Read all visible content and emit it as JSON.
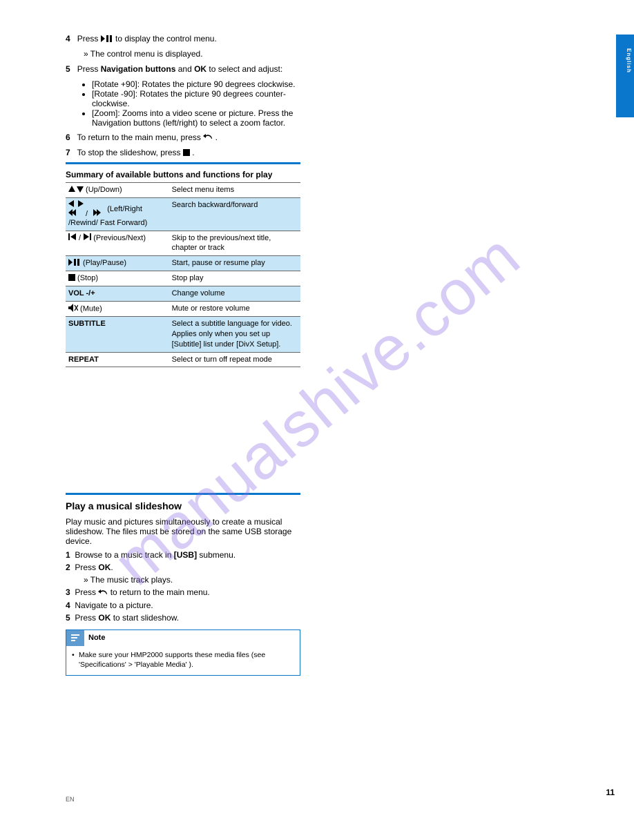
{
  "watermark": "manualshive.com",
  "side_tab": "English",
  "page_num": "11",
  "footer_left": "EN",
  "top": {
    "line1_a": "Press ",
    "line1_b": " to display the control menu.",
    "line1_c": "» The control menu is displayed.",
    "line2_a": "Press ",
    "line2_b": "Navigation buttons",
    "line2_c": " and ",
    "line2_d": "OK",
    "line2_e": " to select and adjust:",
    "bullets": [
      "[Rotate +90]: Rotates the picture 90 degrees clockwise.",
      "[Rotate -90]: Rotates the picture 90 degrees counter-clockwise.",
      "[Zoom]: Zooms into a video scene or picture. Press the Navigation buttons (left/right) to select a zoom factor."
    ],
    "return_a": "To return to the main menu, press ",
    "return_b": ".",
    "stop_a": "To stop the slideshow, press ",
    "stop_b": "."
  },
  "controls_heading": "Summary of available buttons and functions for play",
  "controls_rows": [
    {
      "alt": false,
      "icons": "updown",
      "label": " (Up/Down)",
      "desc": "Select menu items"
    },
    {
      "alt": true,
      "icons": "lr_rewff",
      "label": " (Left/Right /Rewind/ Fast Forward)",
      "desc": "Search backward/forward"
    },
    {
      "alt": false,
      "icons": "prevnext",
      "label": " (Previous/Next)",
      "desc": "Skip to the previous/next title, chapter or track"
    },
    {
      "alt": true,
      "icons": "playpause",
      "label": " (Play/Pause)",
      "desc": "Start, pause or resume play"
    },
    {
      "alt": false,
      "icons": "stop",
      "label": " (Stop)",
      "desc": "Stop play"
    },
    {
      "alt": true,
      "icons": "text",
      "label_text": "VOL -/+",
      "desc": "Change volume"
    },
    {
      "alt": false,
      "icons": "mute",
      "label": " (Mute)",
      "desc": "Mute or restore volume"
    },
    {
      "alt": true,
      "icons": "text",
      "label_text": "SUBTITLE",
      "desc": "Select a subtitle language for video. Applies only when you set up [Subtitle] list under [DivX Setup]."
    },
    {
      "alt": false,
      "icons": "text",
      "label_text": "REPEAT",
      "desc": "Select or turn off repeat mode"
    }
  ],
  "slideshow": {
    "heading": "Play a musical slideshow",
    "intro": "Play music and pictures simultaneously to create a musical slideshow. The files must be stored on the same USB storage device.",
    "steps": [
      {
        "prefix": "Browse to a music track in ",
        "bold": "[USB]",
        "suffix": " submenu."
      },
      {
        "prefix": "Press ",
        "bold": "OK",
        "suffix": "."
      },
      {
        "plain": "» The music track plays."
      },
      {
        "prefix": "Press ",
        "icon": "back",
        "suffix": " to return to the main menu."
      },
      {
        "plain": "Navigate to a picture."
      },
      {
        "prefix": "Press ",
        "bold": "OK",
        "suffix": " to start slideshow."
      }
    ],
    "note_label": "Note",
    "note_text": "Make sure your HMP2000 supports these media files (see 'Specifications' > 'Playable Media' )."
  }
}
